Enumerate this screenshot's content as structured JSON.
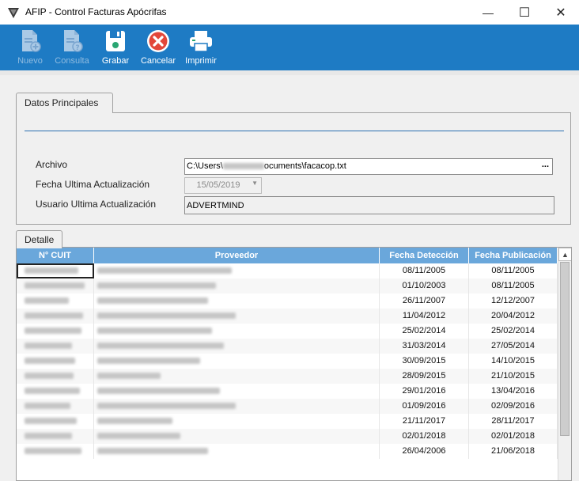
{
  "window": {
    "title": "AFIP - Control Facturas Apócrifas",
    "minimize_glyph": "—",
    "maximize_glyph": "☐",
    "close_glyph": "✕"
  },
  "toolbar": {
    "nuevo_label": "Nuevo",
    "consulta_label": "Consulta",
    "grabar_label": "Grabar",
    "cancelar_label": "Cancelar",
    "imprimir_label": "Imprimir"
  },
  "datos_principales": {
    "tab_label": "Datos Principales",
    "archivo_label": "Archivo",
    "archivo_value_start": "C:\\Users\\",
    "archivo_value_end": "ocuments\\facacop.txt",
    "archivo_browse": "...",
    "fecha_label": "Fecha Ultima Actualización",
    "fecha_value": "15/05/2019",
    "usuario_label": "Usuario Ultima Actualización",
    "usuario_value": "ADVERTMIND"
  },
  "detalle": {
    "tab_label": "Detalle",
    "columns": [
      "N° CUIT",
      "Proveedor",
      "Fecha Detección",
      "Fecha Publicación"
    ],
    "rows": [
      {
        "deteccion": "08/11/2005",
        "publicacion": "08/11/2005"
      },
      {
        "deteccion": "01/10/2003",
        "publicacion": "08/11/2005"
      },
      {
        "deteccion": "26/11/2007",
        "publicacion": "12/12/2007"
      },
      {
        "deteccion": "11/04/2012",
        "publicacion": "20/04/2012"
      },
      {
        "deteccion": "25/02/2014",
        "publicacion": "25/02/2014"
      },
      {
        "deteccion": "31/03/2014",
        "publicacion": "27/05/2014"
      },
      {
        "deteccion": "30/09/2015",
        "publicacion": "14/10/2015"
      },
      {
        "deteccion": "28/09/2015",
        "publicacion": "21/10/2015"
      },
      {
        "deteccion": "29/01/2016",
        "publicacion": "13/04/2016"
      },
      {
        "deteccion": "01/09/2016",
        "publicacion": "02/09/2016"
      },
      {
        "deteccion": "21/11/2017",
        "publicacion": "28/11/2017"
      },
      {
        "deteccion": "02/01/2018",
        "publicacion": "02/01/2018"
      },
      {
        "deteccion": "26/04/2006",
        "publicacion": "21/06/2018"
      }
    ]
  }
}
